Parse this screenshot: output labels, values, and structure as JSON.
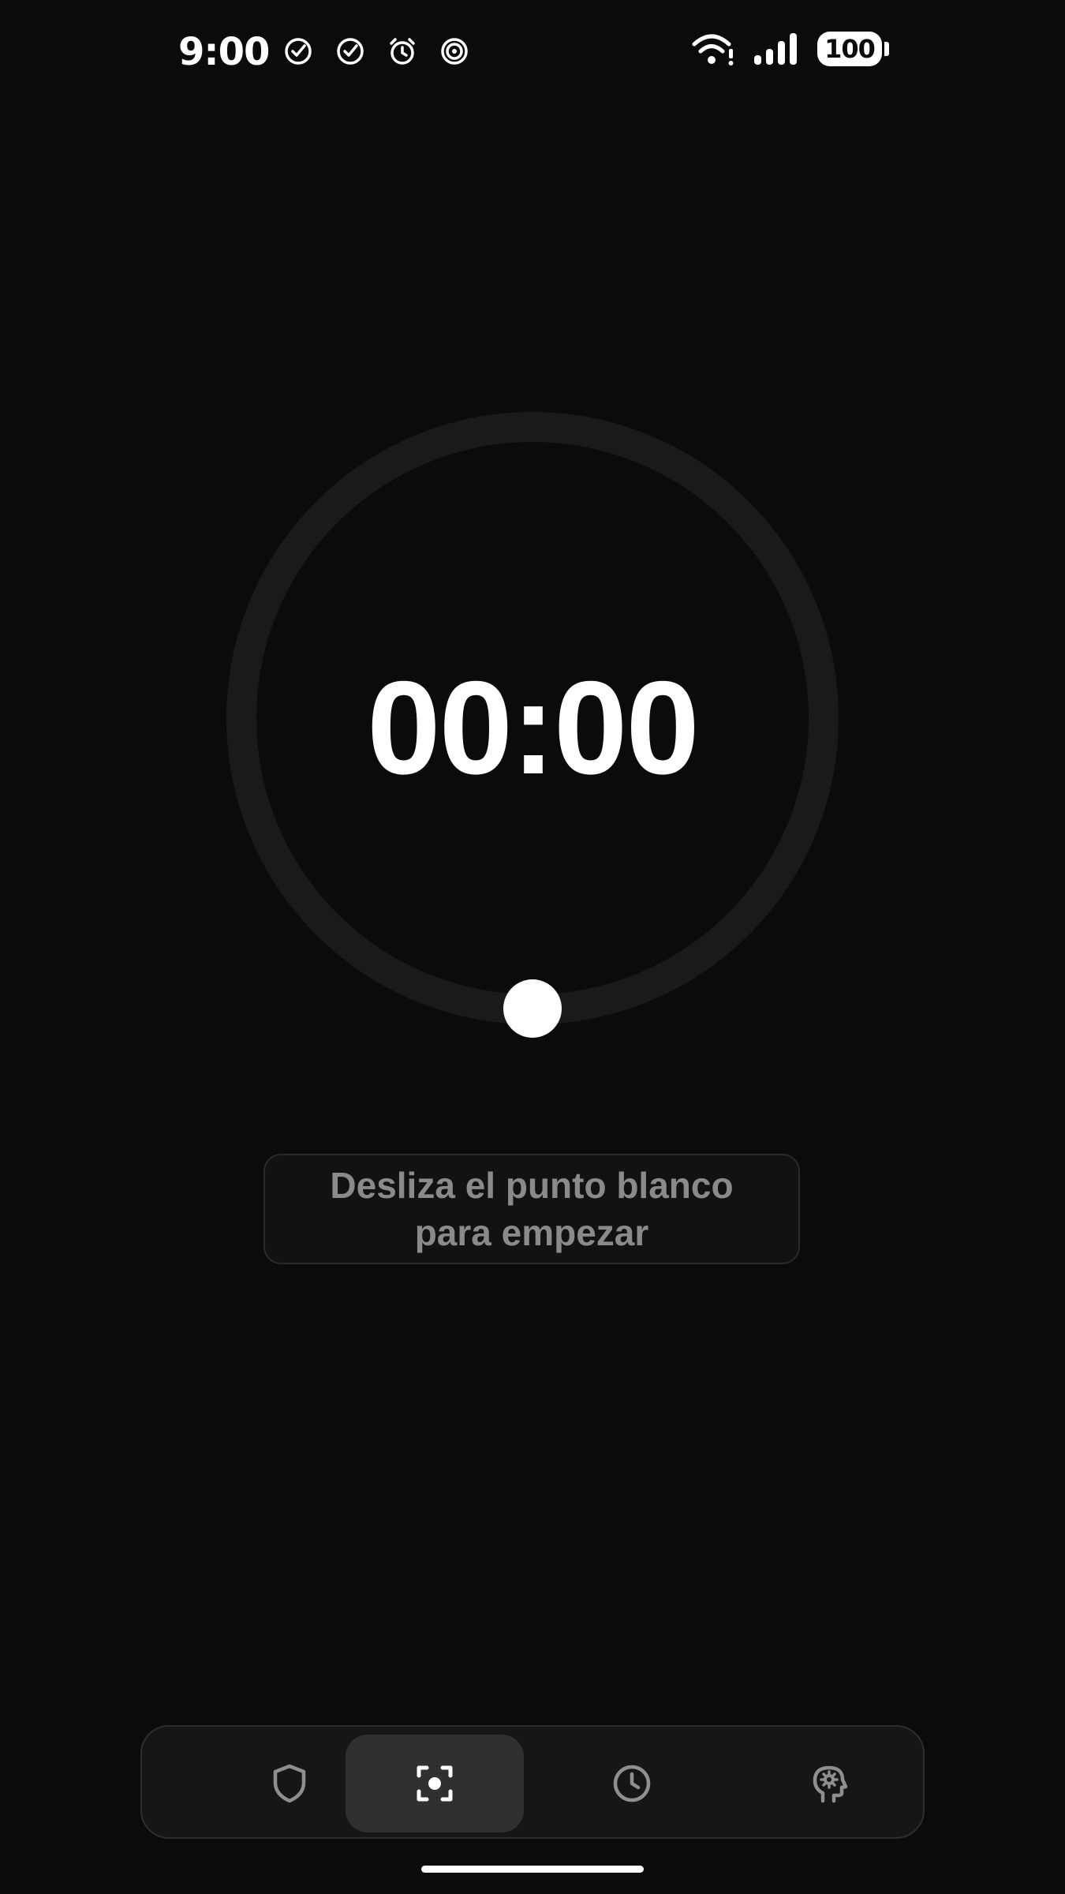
{
  "status_bar": {
    "time": "9:00",
    "left_icons": [
      "check-circle-icon",
      "check-circle-icon",
      "alarm-clock-icon",
      "spiral-icon"
    ],
    "right_icons": [
      "wifi-icon",
      "signal-bars-icon"
    ],
    "battery_level": "100"
  },
  "timer": {
    "display": "00:00",
    "progress": 0
  },
  "hint": {
    "text": "Desliza el punto blanco para empezar"
  },
  "bottom_nav": {
    "items": [
      {
        "id": "block",
        "icon": "shield-icon",
        "active": false
      },
      {
        "id": "focus",
        "icon": "focus-target-icon",
        "active": true
      },
      {
        "id": "history",
        "icon": "clock-icon",
        "active": false
      },
      {
        "id": "mind",
        "icon": "head-gear-icon",
        "active": false
      }
    ]
  },
  "colors": {
    "background": "#0b0b0b",
    "dial_ring": "#1a1a1a",
    "hint_text": "#8a8a8a",
    "nav_background": "#161616",
    "nav_active": "#303030",
    "nav_icon": "#8f8f8f",
    "nav_icon_active": "#ffffff"
  }
}
